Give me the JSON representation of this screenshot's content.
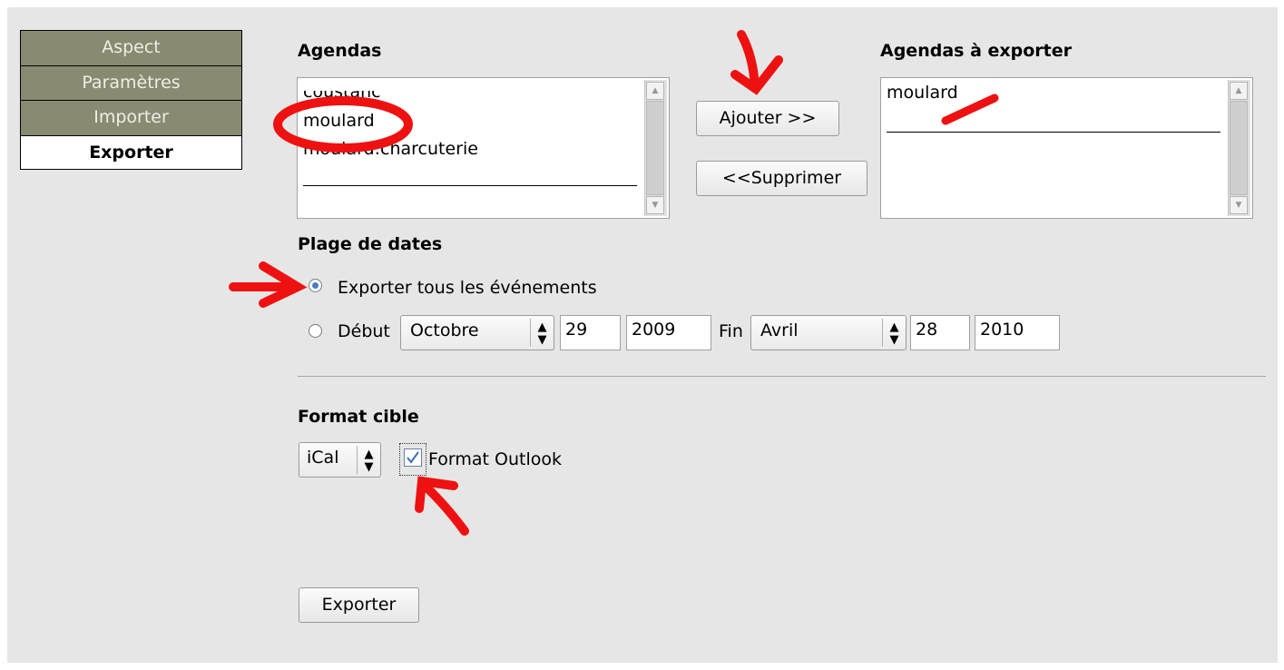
{
  "nav": {
    "items": [
      {
        "label": "Aspect"
      },
      {
        "label": "Paramètres"
      },
      {
        "label": "Importer"
      },
      {
        "label": "Exporter"
      }
    ]
  },
  "agendas": {
    "heading": "Agendas",
    "items": [
      "coustanc",
      "moulard",
      "moulard:charcuterie"
    ]
  },
  "actions": {
    "add_label": "Ajouter >>",
    "remove_label": "<<Supprimer"
  },
  "export_list": {
    "heading": "Agendas à exporter",
    "items": [
      "moulard"
    ]
  },
  "date_range": {
    "heading": "Plage de dates",
    "all_events_label": "Exporter tous les événements",
    "start_label": "Début",
    "start_month": "Octobre",
    "start_day": "29",
    "start_year": "2009",
    "end_label": "Fin",
    "end_month": "Avril",
    "end_day": "28",
    "end_year": "2010",
    "selected": "all"
  },
  "format": {
    "heading": "Format cible",
    "selected": "iCal",
    "outlook_label": "Format Outlook",
    "outlook_checked": true
  },
  "submit": {
    "label": "Exporter"
  },
  "colors": {
    "nav_inactive": "#8a8a72",
    "panel_bg": "#e6e6e6",
    "annotation": "#ee1111",
    "radio_dot": "#4a7cc8"
  }
}
